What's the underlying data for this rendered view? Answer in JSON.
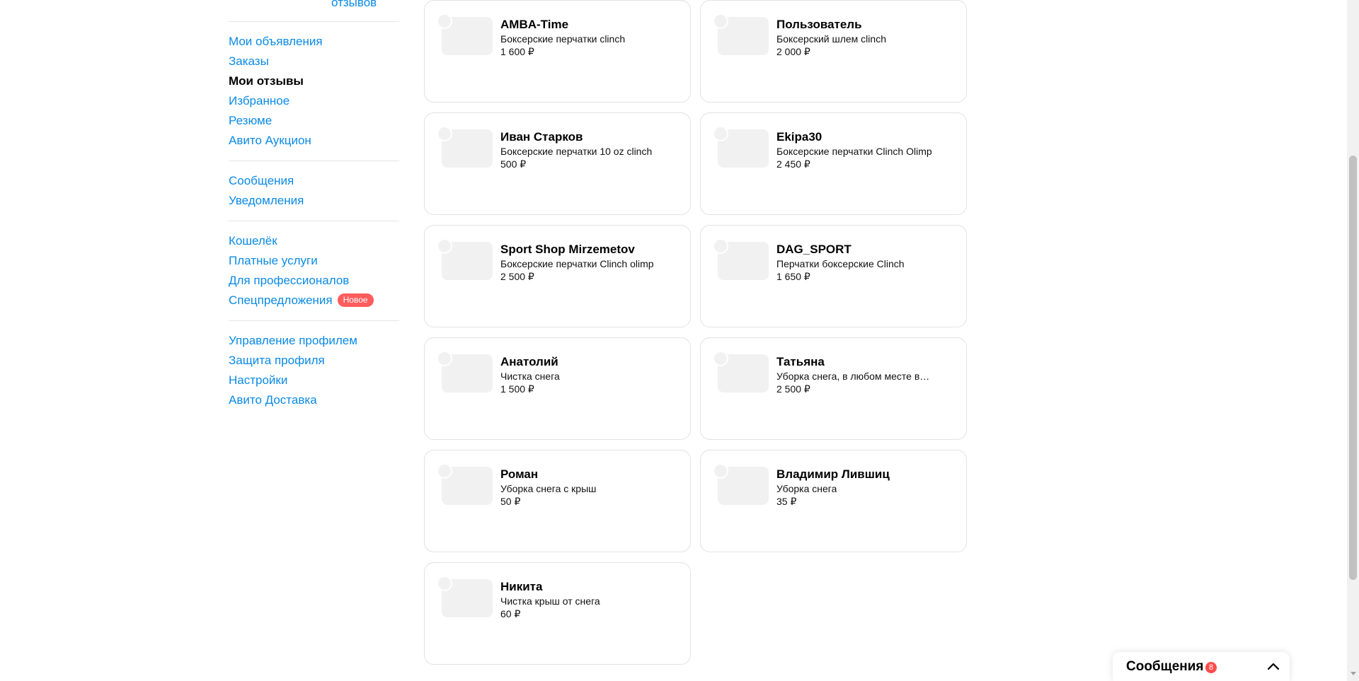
{
  "sidebar": {
    "top_partial_link": "отзывов",
    "groups": [
      {
        "items": [
          {
            "label": "Мои объявления",
            "active": false
          },
          {
            "label": "Заказы",
            "active": false
          },
          {
            "label": "Мои отзывы",
            "active": true
          },
          {
            "label": "Избранное",
            "active": false
          },
          {
            "label": "Резюме",
            "active": false
          },
          {
            "label": "Авито Аукцион",
            "active": false
          }
        ]
      },
      {
        "items": [
          {
            "label": "Сообщения",
            "active": false
          },
          {
            "label": "Уведомления",
            "active": false
          }
        ]
      },
      {
        "items": [
          {
            "label": "Кошелёк",
            "active": false
          },
          {
            "label": "Платные услуги",
            "active": false
          },
          {
            "label": "Для профессионалов",
            "active": false
          },
          {
            "label": "Спецпредложения",
            "active": false,
            "badge": "Новое"
          }
        ]
      },
      {
        "items": [
          {
            "label": "Управление профилем",
            "active": false
          },
          {
            "label": "Защита профиля",
            "active": false
          },
          {
            "label": "Настройки",
            "active": false
          },
          {
            "label": "Авито Доставка",
            "active": false
          }
        ]
      }
    ]
  },
  "cards": [
    {
      "name": "AMBA-Time",
      "title": "Боксерские перчатки clinch",
      "price": "1 600 ₽"
    },
    {
      "name": "Пользователь",
      "title": "Боксерский шлем clinch",
      "price": "2 000 ₽"
    },
    {
      "name": "Иван Старков",
      "title": "Боксерские перчатки 10 oz clinch",
      "price": "500 ₽"
    },
    {
      "name": "Ekipa30",
      "title": "Боксерские перчатки Clinch Olimp",
      "price": "2 450 ₽"
    },
    {
      "name": "Sport Shop Mirzemetov",
      "title": "Боксерские перчатки Clinch olimp",
      "price": "2 500 ₽"
    },
    {
      "name": "DAG_SPORT",
      "title": "Перчатки боксерские Clinch",
      "price": "1 650 ₽"
    },
    {
      "name": "Анатолий",
      "title": "Чистка снега",
      "price": "1 500 ₽"
    },
    {
      "name": "Татьяна",
      "title": "Уборка снега, в любом месте в городе",
      "price": "2 500 ₽"
    },
    {
      "name": "Роман",
      "title": "Уборка снега с крыш",
      "price": "50 ₽"
    },
    {
      "name": "Владимир Лившиц",
      "title": "Уборка снега",
      "price": "35 ₽"
    },
    {
      "name": "Никита",
      "title": "Чистка крыш от снега",
      "price": "60 ₽"
    }
  ],
  "messenger": {
    "label": "Сообщения",
    "unread_count": "8"
  },
  "colors": {
    "link": "#0a8ae6",
    "badge": "#ff5c5c",
    "card_border": "#e2e2e2"
  }
}
